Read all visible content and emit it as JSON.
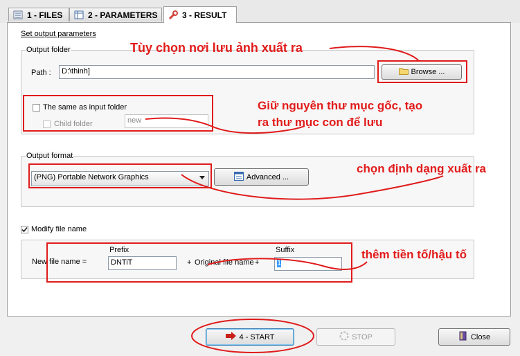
{
  "tabs": [
    {
      "label": "1 - FILES",
      "icon": "list-icon"
    },
    {
      "label": "2 - PARAMETERS",
      "icon": "grid-icon"
    },
    {
      "label": "3 - RESULT",
      "icon": "tools-icon"
    }
  ],
  "section_title": "Set output parameters",
  "output_folder": {
    "group_title": "Output folder",
    "path_label": "Path :",
    "path_value": "D:\\thinh]",
    "browse_label": "Browse ...",
    "same_as_input_label": "The same as input folder",
    "child_folder_label": "Child folder",
    "child_folder_value": "new"
  },
  "output_format": {
    "group_title": "Output format",
    "selected": "(PNG) Portable Network Graphics",
    "advanced_label": "Advanced ..."
  },
  "modify_file_name": {
    "label": "Modify file name",
    "checked": true,
    "new_file_name_label": "New file name =",
    "prefix_label": "Prefix",
    "prefix_value": "DNTiT",
    "plus1": "+",
    "original_label": "Original file name",
    "plus2": "+",
    "suffix_label": "Suffix",
    "suffix_value": "1"
  },
  "buttons": {
    "start": "4 - START",
    "stop": "STOP",
    "close": "Close"
  },
  "annotations": {
    "folder_note": "Tùy chọn nơi lưu ảnh xuất ra",
    "keep_note_line1": "Giữ nguyên thư mục gốc, tạo",
    "keep_note_line2": "ra thư mục con để lưu",
    "format_note": "chọn định dạng xuất ra",
    "suffix_note": "thêm tiền tố/hậu tố"
  },
  "colors": {
    "annotation": "#e21b1b"
  }
}
